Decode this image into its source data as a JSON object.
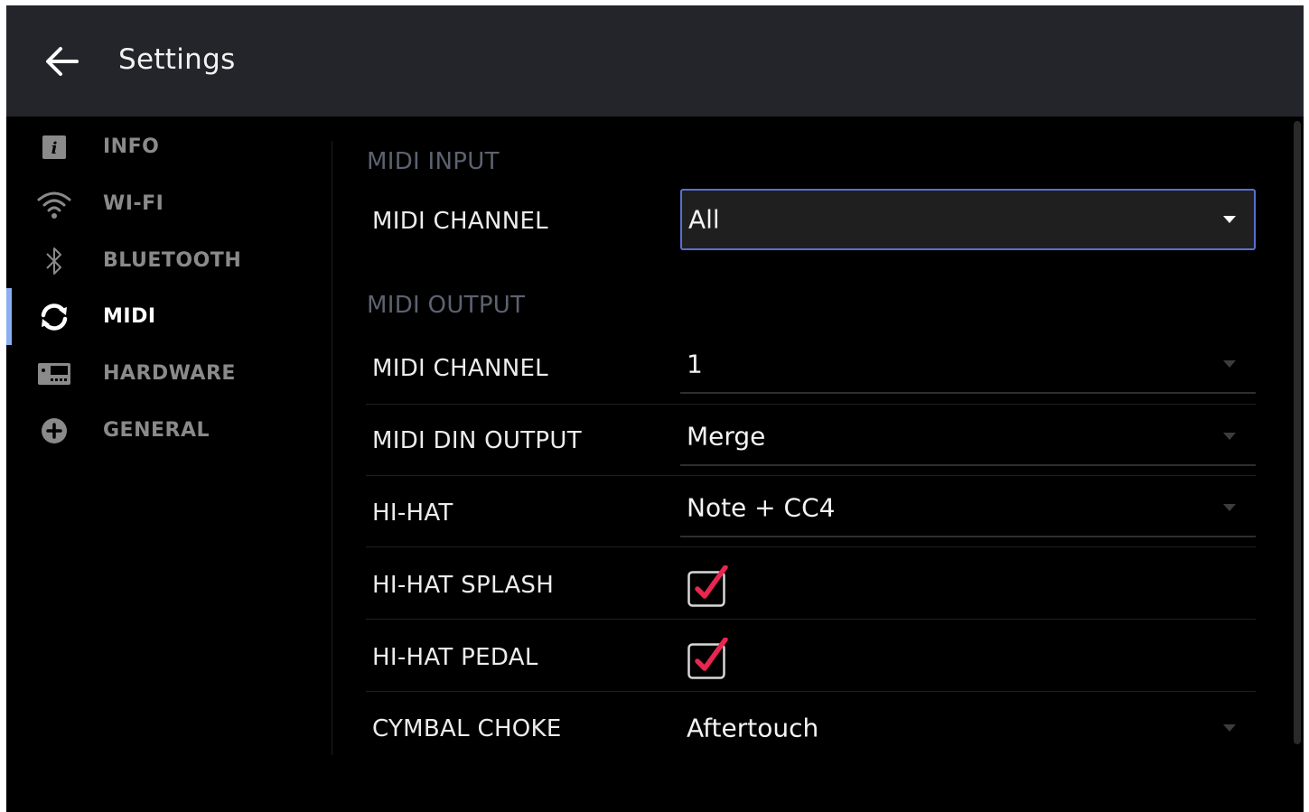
{
  "header": {
    "title": "Settings",
    "back_icon": "arrow-left-icon"
  },
  "sidebar": {
    "items": [
      {
        "label": "INFO",
        "icon": "info-icon",
        "active": false
      },
      {
        "label": "WI-FI",
        "icon": "wifi-icon",
        "active": false
      },
      {
        "label": "BLUETOOTH",
        "icon": "bluetooth-icon",
        "active": false
      },
      {
        "label": "MIDI",
        "icon": "sync-icon",
        "active": true
      },
      {
        "label": "HARDWARE",
        "icon": "hardware-icon",
        "active": false
      },
      {
        "label": "GENERAL",
        "icon": "plus-circle-icon",
        "active": false
      }
    ]
  },
  "midi_input": {
    "title": "MIDI INPUT",
    "midi_channel": {
      "label": "MIDI CHANNEL",
      "value": "All"
    }
  },
  "midi_output": {
    "title": "MIDI OUTPUT",
    "midi_channel": {
      "label": "MIDI CHANNEL",
      "value": "1"
    },
    "midi_din_output": {
      "label": "MIDI DIN OUTPUT",
      "value": "Merge"
    },
    "hi_hat": {
      "label": "HI-HAT",
      "value": "Note + CC4"
    },
    "hi_hat_splash": {
      "label": "HI-HAT SPLASH",
      "checked": true
    },
    "hi_hat_pedal": {
      "label": "HI-HAT PEDAL",
      "checked": true
    },
    "cymbal_choke": {
      "label": "CYMBAL CHOKE",
      "value": "Aftertouch"
    }
  },
  "colors": {
    "header_bg": "#23252b",
    "accent": "#8ab0f2",
    "focus_border": "#5a6fd0",
    "check_mark": "#e8264f",
    "section_title": "#5d6270"
  }
}
